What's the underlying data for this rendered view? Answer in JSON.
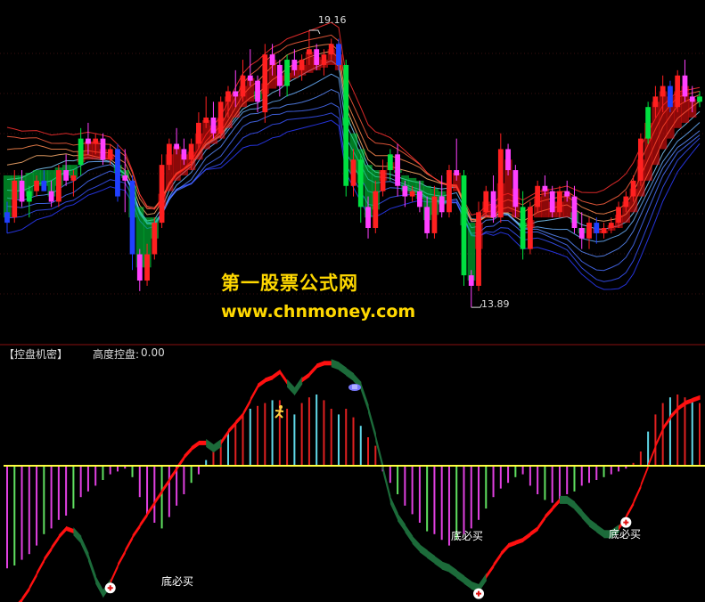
{
  "watermark": {
    "line1": "第一股票公式网",
    "line2": "www.chnmoney.com"
  },
  "indicator": {
    "name": "【控盘机密】",
    "label": "高度控盘:",
    "value": "0.00"
  },
  "price_high_label": "19.16",
  "price_low_label": "13.89",
  "signal_label": "底必买",
  "colors": {
    "background": "#000000",
    "bull": "#ff2020",
    "bear_green": "#00e040",
    "bear_blue": "#2040ff",
    "neutral": "#ff40ff",
    "zero_line": "#ffff40",
    "rising_band": "#ff1010",
    "falling_band": "#1c6b3a",
    "hist_red": "#e02020",
    "hist_cyan": "#60d8e8",
    "hist_green": "#60e060",
    "hist_magenta": "#e040e0"
  },
  "chart_data": [
    {
      "type": "candlestick",
      "title": "",
      "ylim": [
        13.3,
        19.6
      ],
      "annotations": [
        {
          "text": "19.16",
          "value": 19.16,
          "bar": 41
        },
        {
          "text": "13.89",
          "value": 13.89,
          "bar": 63
        }
      ],
      "grid": true,
      "candles": [
        {
          "o": 15.7,
          "h": 15.9,
          "l": 15.3,
          "c": 15.5
        },
        {
          "o": 15.6,
          "h": 16.5,
          "l": 15.5,
          "c": 16.3
        },
        {
          "o": 16.3,
          "h": 16.5,
          "l": 15.8,
          "c": 15.9
        },
        {
          "o": 15.9,
          "h": 16.2,
          "l": 15.6,
          "c": 16.1
        },
        {
          "o": 16.1,
          "h": 16.4,
          "l": 16.0,
          "c": 16.3
        },
        {
          "o": 16.3,
          "h": 16.5,
          "l": 16.1,
          "c": 16.1
        },
        {
          "o": 16.1,
          "h": 16.3,
          "l": 15.8,
          "c": 15.9
        },
        {
          "o": 15.9,
          "h": 16.6,
          "l": 15.8,
          "c": 16.5
        },
        {
          "o": 16.5,
          "h": 16.8,
          "l": 16.2,
          "c": 16.3
        },
        {
          "o": 16.3,
          "h": 16.5,
          "l": 16.0,
          "c": 16.4
        },
        {
          "o": 16.6,
          "h": 17.3,
          "l": 16.4,
          "c": 17.1
        },
        {
          "o": 17.1,
          "h": 17.4,
          "l": 16.8,
          "c": 17.0
        },
        {
          "o": 17.0,
          "h": 17.2,
          "l": 16.8,
          "c": 17.1
        },
        {
          "o": 17.1,
          "h": 17.2,
          "l": 16.6,
          "c": 16.7
        },
        {
          "o": 16.7,
          "h": 17.0,
          "l": 16.6,
          "c": 16.9
        },
        {
          "o": 16.9,
          "h": 17.0,
          "l": 15.9,
          "c": 16.0
        },
        {
          "o": 16.4,
          "h": 16.9,
          "l": 15.7,
          "c": 16.3
        },
        {
          "o": 16.3,
          "h": 16.4,
          "l": 14.6,
          "c": 14.9
        },
        {
          "o": 14.9,
          "h": 15.0,
          "l": 14.2,
          "c": 14.4
        },
        {
          "o": 14.4,
          "h": 15.1,
          "l": 14.3,
          "c": 14.9
        },
        {
          "o": 14.9,
          "h": 15.6,
          "l": 14.8,
          "c": 15.5
        },
        {
          "o": 15.5,
          "h": 16.8,
          "l": 15.4,
          "c": 16.6
        },
        {
          "o": 16.6,
          "h": 17.1,
          "l": 16.5,
          "c": 17.0
        },
        {
          "o": 17.0,
          "h": 17.3,
          "l": 16.8,
          "c": 16.9
        },
        {
          "o": 16.9,
          "h": 17.1,
          "l": 16.6,
          "c": 16.7
        },
        {
          "o": 16.7,
          "h": 17.1,
          "l": 16.5,
          "c": 17.0
        },
        {
          "o": 17.0,
          "h": 17.6,
          "l": 16.9,
          "c": 17.4
        },
        {
          "o": 17.4,
          "h": 17.9,
          "l": 17.3,
          "c": 17.5
        },
        {
          "o": 17.5,
          "h": 17.8,
          "l": 17.1,
          "c": 17.2
        },
        {
          "o": 17.2,
          "h": 17.9,
          "l": 17.1,
          "c": 17.8
        },
        {
          "o": 17.8,
          "h": 18.1,
          "l": 17.5,
          "c": 18.0
        },
        {
          "o": 18.0,
          "h": 18.4,
          "l": 17.7,
          "c": 17.9
        },
        {
          "o": 17.9,
          "h": 18.6,
          "l": 17.8,
          "c": 18.3
        },
        {
          "o": 18.3,
          "h": 18.8,
          "l": 18.1,
          "c": 18.2
        },
        {
          "o": 18.2,
          "h": 18.3,
          "l": 17.6,
          "c": 17.8
        },
        {
          "o": 17.6,
          "h": 18.9,
          "l": 17.4,
          "c": 18.7
        },
        {
          "o": 18.7,
          "h": 18.9,
          "l": 18.3,
          "c": 18.5
        },
        {
          "o": 18.5,
          "h": 18.6,
          "l": 17.9,
          "c": 18.1
        },
        {
          "o": 18.1,
          "h": 18.7,
          "l": 17.9,
          "c": 18.6
        },
        {
          "o": 18.6,
          "h": 18.8,
          "l": 18.3,
          "c": 18.4
        },
        {
          "o": 18.4,
          "h": 18.7,
          "l": 18.2,
          "c": 18.6
        },
        {
          "o": 18.7,
          "h": 19.16,
          "l": 18.5,
          "c": 18.8
        },
        {
          "o": 18.8,
          "h": 18.9,
          "l": 18.4,
          "c": 18.5
        },
        {
          "o": 18.5,
          "h": 18.8,
          "l": 18.3,
          "c": 18.7
        },
        {
          "o": 18.7,
          "h": 19.0,
          "l": 18.6,
          "c": 18.9
        },
        {
          "o": 18.9,
          "h": 19.0,
          "l": 18.4,
          "c": 18.5
        },
        {
          "o": 18.5,
          "h": 18.6,
          "l": 16.0,
          "c": 16.2
        },
        {
          "o": 16.2,
          "h": 16.9,
          "l": 16.0,
          "c": 16.7
        },
        {
          "o": 16.7,
          "h": 16.8,
          "l": 15.5,
          "c": 15.8
        },
        {
          "o": 15.8,
          "h": 16.0,
          "l": 15.2,
          "c": 15.4
        },
        {
          "o": 15.4,
          "h": 16.3,
          "l": 15.3,
          "c": 16.1
        },
        {
          "o": 16.1,
          "h": 16.7,
          "l": 16.0,
          "c": 16.5
        },
        {
          "o": 16.5,
          "h": 16.9,
          "l": 16.3,
          "c": 16.8
        },
        {
          "o": 16.8,
          "h": 17.0,
          "l": 16.0,
          "c": 16.2
        },
        {
          "o": 16.2,
          "h": 16.3,
          "l": 15.8,
          "c": 16.0
        },
        {
          "o": 16.0,
          "h": 16.2,
          "l": 15.9,
          "c": 16.1
        },
        {
          "o": 16.1,
          "h": 16.3,
          "l": 15.7,
          "c": 15.8
        },
        {
          "o": 15.8,
          "h": 16.0,
          "l": 15.2,
          "c": 15.3
        },
        {
          "o": 15.3,
          "h": 16.2,
          "l": 15.2,
          "c": 16.0
        },
        {
          "o": 16.0,
          "h": 16.4,
          "l": 15.6,
          "c": 15.7
        },
        {
          "o": 15.7,
          "h": 16.6,
          "l": 15.6,
          "c": 16.5
        },
        {
          "o": 16.5,
          "h": 17.1,
          "l": 16.3,
          "c": 16.4
        },
        {
          "o": 16.4,
          "h": 16.5,
          "l": 14.3,
          "c": 14.5
        },
        {
          "o": 14.5,
          "h": 14.6,
          "l": 13.89,
          "c": 14.3
        },
        {
          "o": 14.3,
          "h": 15.9,
          "l": 14.2,
          "c": 15.7
        },
        {
          "o": 15.7,
          "h": 16.2,
          "l": 15.6,
          "c": 16.1
        },
        {
          "o": 16.1,
          "h": 16.4,
          "l": 15.5,
          "c": 15.6
        },
        {
          "o": 15.6,
          "h": 17.2,
          "l": 15.5,
          "c": 16.9
        },
        {
          "o": 16.9,
          "h": 17.0,
          "l": 16.4,
          "c": 16.5
        },
        {
          "o": 16.5,
          "h": 16.6,
          "l": 15.6,
          "c": 15.8
        },
        {
          "o": 15.8,
          "h": 16.1,
          "l": 14.8,
          "c": 15.0
        },
        {
          "o": 15.0,
          "h": 15.9,
          "l": 14.9,
          "c": 15.8
        },
        {
          "o": 15.8,
          "h": 16.3,
          "l": 15.7,
          "c": 16.2
        },
        {
          "o": 16.2,
          "h": 16.4,
          "l": 16.0,
          "c": 16.1
        },
        {
          "o": 16.1,
          "h": 16.2,
          "l": 15.6,
          "c": 15.7
        },
        {
          "o": 15.7,
          "h": 16.2,
          "l": 15.6,
          "c": 16.1
        },
        {
          "o": 16.1,
          "h": 16.3,
          "l": 15.9,
          "c": 16.0
        },
        {
          "o": 16.0,
          "h": 16.2,
          "l": 15.3,
          "c": 15.4
        },
        {
          "o": 15.4,
          "h": 15.7,
          "l": 15.0,
          "c": 15.2
        },
        {
          "o": 15.2,
          "h": 15.6,
          "l": 15.0,
          "c": 15.5
        },
        {
          "o": 15.5,
          "h": 15.6,
          "l": 15.1,
          "c": 15.3
        },
        {
          "o": 15.3,
          "h": 15.5,
          "l": 15.2,
          "c": 15.4
        },
        {
          "o": 15.4,
          "h": 15.6,
          "l": 15.3,
          "c": 15.5
        },
        {
          "o": 15.5,
          "h": 15.9,
          "l": 15.4,
          "c": 15.8
        },
        {
          "o": 15.8,
          "h": 16.1,
          "l": 15.7,
          "c": 16.0
        },
        {
          "o": 16.0,
          "h": 16.4,
          "l": 15.9,
          "c": 16.3
        },
        {
          "o": 16.3,
          "h": 17.2,
          "l": 16.2,
          "c": 17.1
        },
        {
          "o": 17.1,
          "h": 17.8,
          "l": 17.0,
          "c": 17.7
        },
        {
          "o": 17.7,
          "h": 18.1,
          "l": 17.5,
          "c": 17.9
        },
        {
          "o": 17.9,
          "h": 18.3,
          "l": 17.6,
          "c": 18.1
        },
        {
          "o": 18.1,
          "h": 18.2,
          "l": 17.6,
          "c": 17.7
        },
        {
          "o": 17.7,
          "h": 18.4,
          "l": 17.6,
          "c": 18.3
        },
        {
          "o": 18.3,
          "h": 18.6,
          "l": 17.8,
          "c": 17.9
        },
        {
          "o": 17.9,
          "h": 18.1,
          "l": 17.6,
          "c": 17.8
        },
        {
          "o": 17.8,
          "h": 18.0,
          "l": 17.7,
          "c": 17.9
        }
      ],
      "ribbon_levels": [
        16.4,
        16.4,
        16.4,
        16.45,
        16.5,
        16.5,
        16.5,
        16.55,
        16.6,
        16.6,
        16.65,
        16.7,
        16.7,
        16.7,
        16.7,
        16.6,
        16.5,
        16.2,
        15.8,
        15.6,
        15.6,
        15.8,
        16.1,
        16.3,
        16.4,
        16.5,
        16.7,
        16.9,
        17.0,
        17.1,
        17.3,
        17.5,
        17.7,
        17.8,
        17.85,
        17.95,
        18.05,
        18.1,
        18.2,
        18.25,
        18.3,
        18.35,
        18.4,
        18.45,
        18.5,
        18.4,
        17.5,
        17.2,
        16.9,
        16.6,
        16.5,
        16.5,
        16.5,
        16.45,
        16.4,
        16.35,
        16.3,
        16.2,
        16.15,
        16.1,
        16.1,
        16.1,
        15.8,
        15.5,
        15.5,
        15.6,
        15.6,
        15.7,
        15.7,
        15.6,
        15.5,
        15.55,
        15.6,
        15.6,
        15.6,
        15.6,
        15.6,
        15.5,
        15.4,
        15.35,
        15.3,
        15.3,
        15.35,
        15.4,
        15.5,
        15.7,
        16.0,
        16.3,
        16.6,
        16.9,
        17.1,
        17.3,
        17.4,
        17.5,
        17.6
      ]
    },
    {
      "type": "histogram_with_band",
      "title": "【控盘机密】",
      "legend": [
        "高度控盘: 0.00"
      ],
      "ylim": [
        -1.0,
        1.0
      ],
      "zero_line": 0,
      "histogram": [
        -0.72,
        -0.7,
        -0.66,
        -0.62,
        -0.56,
        -0.48,
        -0.44,
        -0.38,
        -0.35,
        -0.3,
        -0.22,
        -0.18,
        -0.14,
        -0.1,
        -0.06,
        -0.04,
        -0.02,
        -0.08,
        -0.22,
        -0.34,
        -0.4,
        -0.44,
        -0.36,
        -0.28,
        -0.2,
        -0.12,
        -0.06,
        0.04,
        0.1,
        0.18,
        0.24,
        0.3,
        0.36,
        0.4,
        0.42,
        0.44,
        0.46,
        0.46,
        0.4,
        0.36,
        0.44,
        0.48,
        0.5,
        0.46,
        0.4,
        0.36,
        0.4,
        0.34,
        0.28,
        0.2,
        0.14,
        -0.04,
        -0.12,
        -0.2,
        -0.28,
        -0.34,
        -0.4,
        -0.46,
        -0.48,
        -0.52,
        -0.56,
        -0.52,
        -0.48,
        -0.44,
        -0.38,
        -0.3,
        -0.22,
        -0.16,
        -0.12,
        -0.08,
        -0.06,
        -0.14,
        -0.2,
        -0.24,
        -0.26,
        -0.24,
        -0.2,
        -0.18,
        -0.14,
        -0.12,
        -0.1,
        -0.08,
        -0.06,
        -0.04,
        -0.02,
        0.02,
        0.1,
        0.24,
        0.36,
        0.44,
        0.48,
        0.5,
        0.48,
        0.46,
        0.44
      ],
      "band": [
        -1.06,
        -1.0,
        -0.94,
        -0.86,
        -0.76,
        -0.66,
        -0.58,
        -0.5,
        -0.44,
        -0.46,
        -0.52,
        -0.64,
        -0.8,
        -0.9,
        -0.82,
        -0.7,
        -0.6,
        -0.5,
        -0.42,
        -0.34,
        -0.26,
        -0.18,
        -0.1,
        -0.02,
        0.06,
        0.12,
        0.16,
        0.16,
        0.12,
        0.16,
        0.24,
        0.3,
        0.36,
        0.46,
        0.56,
        0.6,
        0.62,
        0.66,
        0.58,
        0.52,
        0.6,
        0.64,
        0.7,
        0.72,
        0.72,
        0.7,
        0.66,
        0.62,
        0.56,
        0.4,
        0.2,
        -0.02,
        -0.24,
        -0.36,
        -0.44,
        -0.52,
        -0.58,
        -0.62,
        -0.66,
        -0.7,
        -0.72,
        -0.76,
        -0.8,
        -0.84,
        -0.86,
        -0.78,
        -0.7,
        -0.62,
        -0.56,
        -0.54,
        -0.52,
        -0.48,
        -0.44,
        -0.36,
        -0.3,
        -0.24,
        -0.24,
        -0.28,
        -0.34,
        -0.4,
        -0.44,
        -0.48,
        -0.48,
        -0.44,
        -0.36,
        -0.26,
        -0.14,
        0.0,
        0.14,
        0.26,
        0.34,
        0.4,
        0.44,
        0.46,
        0.48
      ],
      "band_rising": [
        1,
        1,
        1,
        1,
        1,
        1,
        1,
        1,
        1,
        0,
        0,
        0,
        0,
        0,
        1,
        1,
        1,
        1,
        1,
        1,
        1,
        1,
        1,
        1,
        1,
        1,
        1,
        0,
        0,
        1,
        1,
        1,
        1,
        1,
        1,
        1,
        1,
        1,
        0,
        0,
        1,
        1,
        1,
        1,
        0,
        0,
        0,
        0,
        0,
        0,
        0,
        0,
        0,
        0,
        0,
        0,
        0,
        0,
        0,
        0,
        0,
        0,
        0,
        0,
        0,
        1,
        1,
        1,
        1,
        1,
        1,
        1,
        1,
        1,
        1,
        0,
        0,
        0,
        0,
        0,
        0,
        0,
        0,
        1,
        1,
        1,
        1,
        1,
        1,
        1,
        1,
        1,
        1,
        1,
        1
      ],
      "signals": [
        {
          "text": "底必买",
          "bar": 14
        },
        {
          "text": "底必买",
          "bar": 64
        },
        {
          "text": "底必买",
          "bar": 84
        }
      ]
    }
  ]
}
